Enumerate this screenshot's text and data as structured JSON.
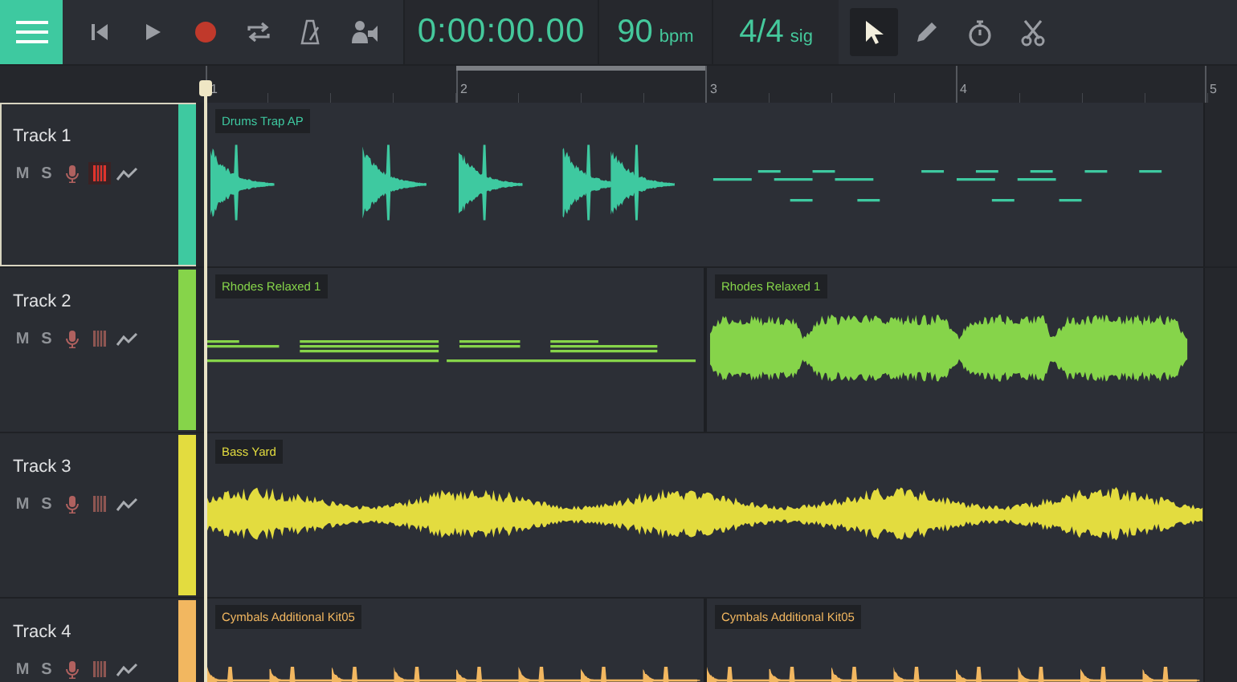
{
  "toolbar": {
    "time": "0:00:00.00",
    "tempo": {
      "value": "90",
      "unit": "bpm"
    },
    "signature": {
      "value": "4/4",
      "unit": "sig"
    },
    "tools": [
      {
        "kind": "pointer",
        "selected": true
      },
      {
        "kind": "pencil",
        "selected": false
      },
      {
        "kind": "stopwatch",
        "selected": false
      },
      {
        "kind": "scissors",
        "selected": false
      }
    ]
  },
  "ruler": {
    "bars": [
      "1",
      "2",
      "3",
      "4",
      "5"
    ]
  },
  "tracks": [
    {
      "name": "Track 1",
      "selected": true,
      "color": "#3ec9a0",
      "mute": "M",
      "solo": "S",
      "keys_active": true,
      "clips": [
        {
          "name": "Drums Trap AP",
          "kind": "mixed"
        }
      ]
    },
    {
      "name": "Track 2",
      "selected": false,
      "color": "#86d44a",
      "mute": "M",
      "solo": "S",
      "keys_active": false,
      "clips": [
        {
          "name": "Rhodes Relaxed 1",
          "kind": "notes"
        },
        {
          "name": "Rhodes Relaxed 1",
          "kind": "wave"
        }
      ]
    },
    {
      "name": "Track 3",
      "selected": false,
      "color": "#e3dc3f",
      "mute": "M",
      "solo": "S",
      "keys_active": false,
      "clips": [
        {
          "name": "Bass Yard",
          "kind": "dense"
        }
      ]
    },
    {
      "name": "Track 4",
      "selected": false,
      "color": "#f2b760",
      "mute": "M",
      "solo": "S",
      "keys_active": false,
      "clips": [
        {
          "name": "Cymbals Additional Kit05",
          "kind": "hits"
        },
        {
          "name": "Cymbals Additional Kit05",
          "kind": "hits"
        }
      ]
    }
  ]
}
